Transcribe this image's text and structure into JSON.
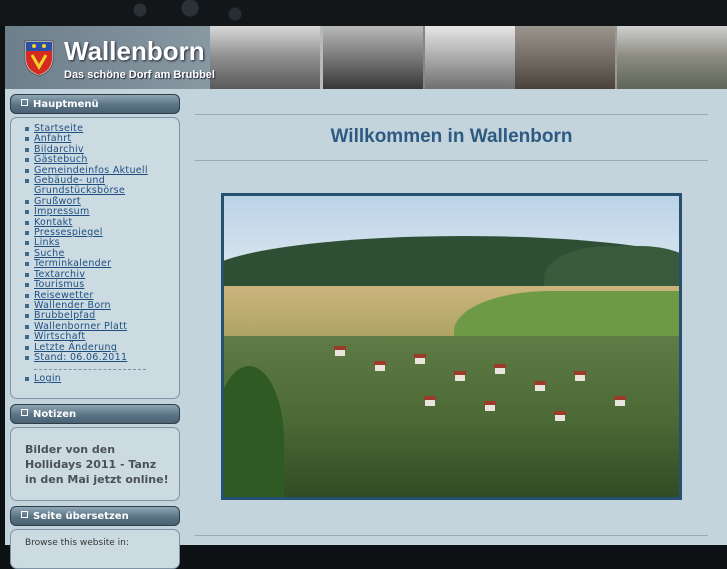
{
  "site": {
    "title": "Wallenborn",
    "subtitle": "Das schöne Dorf am Brubbel"
  },
  "main_menu": {
    "heading": "Hauptmenü",
    "items": [
      "Startseite",
      "Anfahrt",
      "Bildarchiv",
      "Gästebuch",
      "Gemeindeinfos Aktuell",
      "Gebäude- und Grundstücksbörse",
      "Grußwort",
      "Impressum",
      "Kontakt",
      "Pressespiegel",
      "Links",
      "Suche",
      "Terminkalender",
      "Textarchiv",
      "Tourismus",
      "Reisewetter",
      "Wallender Born",
      "Brubbelpfad",
      "Wallenborner Platt",
      "Wirtschaft",
      "Letzte Änderung",
      "Stand: 06.06.2011"
    ],
    "login": "Login"
  },
  "notes": {
    "heading": "Notizen",
    "text": "Bilder von den Hollidays 2011 - Tanz in den Mai jetzt online!"
  },
  "translate": {
    "heading": "Seite übersetzen",
    "text": "Browse this website in:"
  },
  "content": {
    "welcome": "Willkommen in Wallenborn"
  },
  "colors": {
    "page_bg": "#c4d4dc",
    "link": "#1f4f80",
    "heading": "#2d5a80",
    "module_head": "#5a7385"
  }
}
